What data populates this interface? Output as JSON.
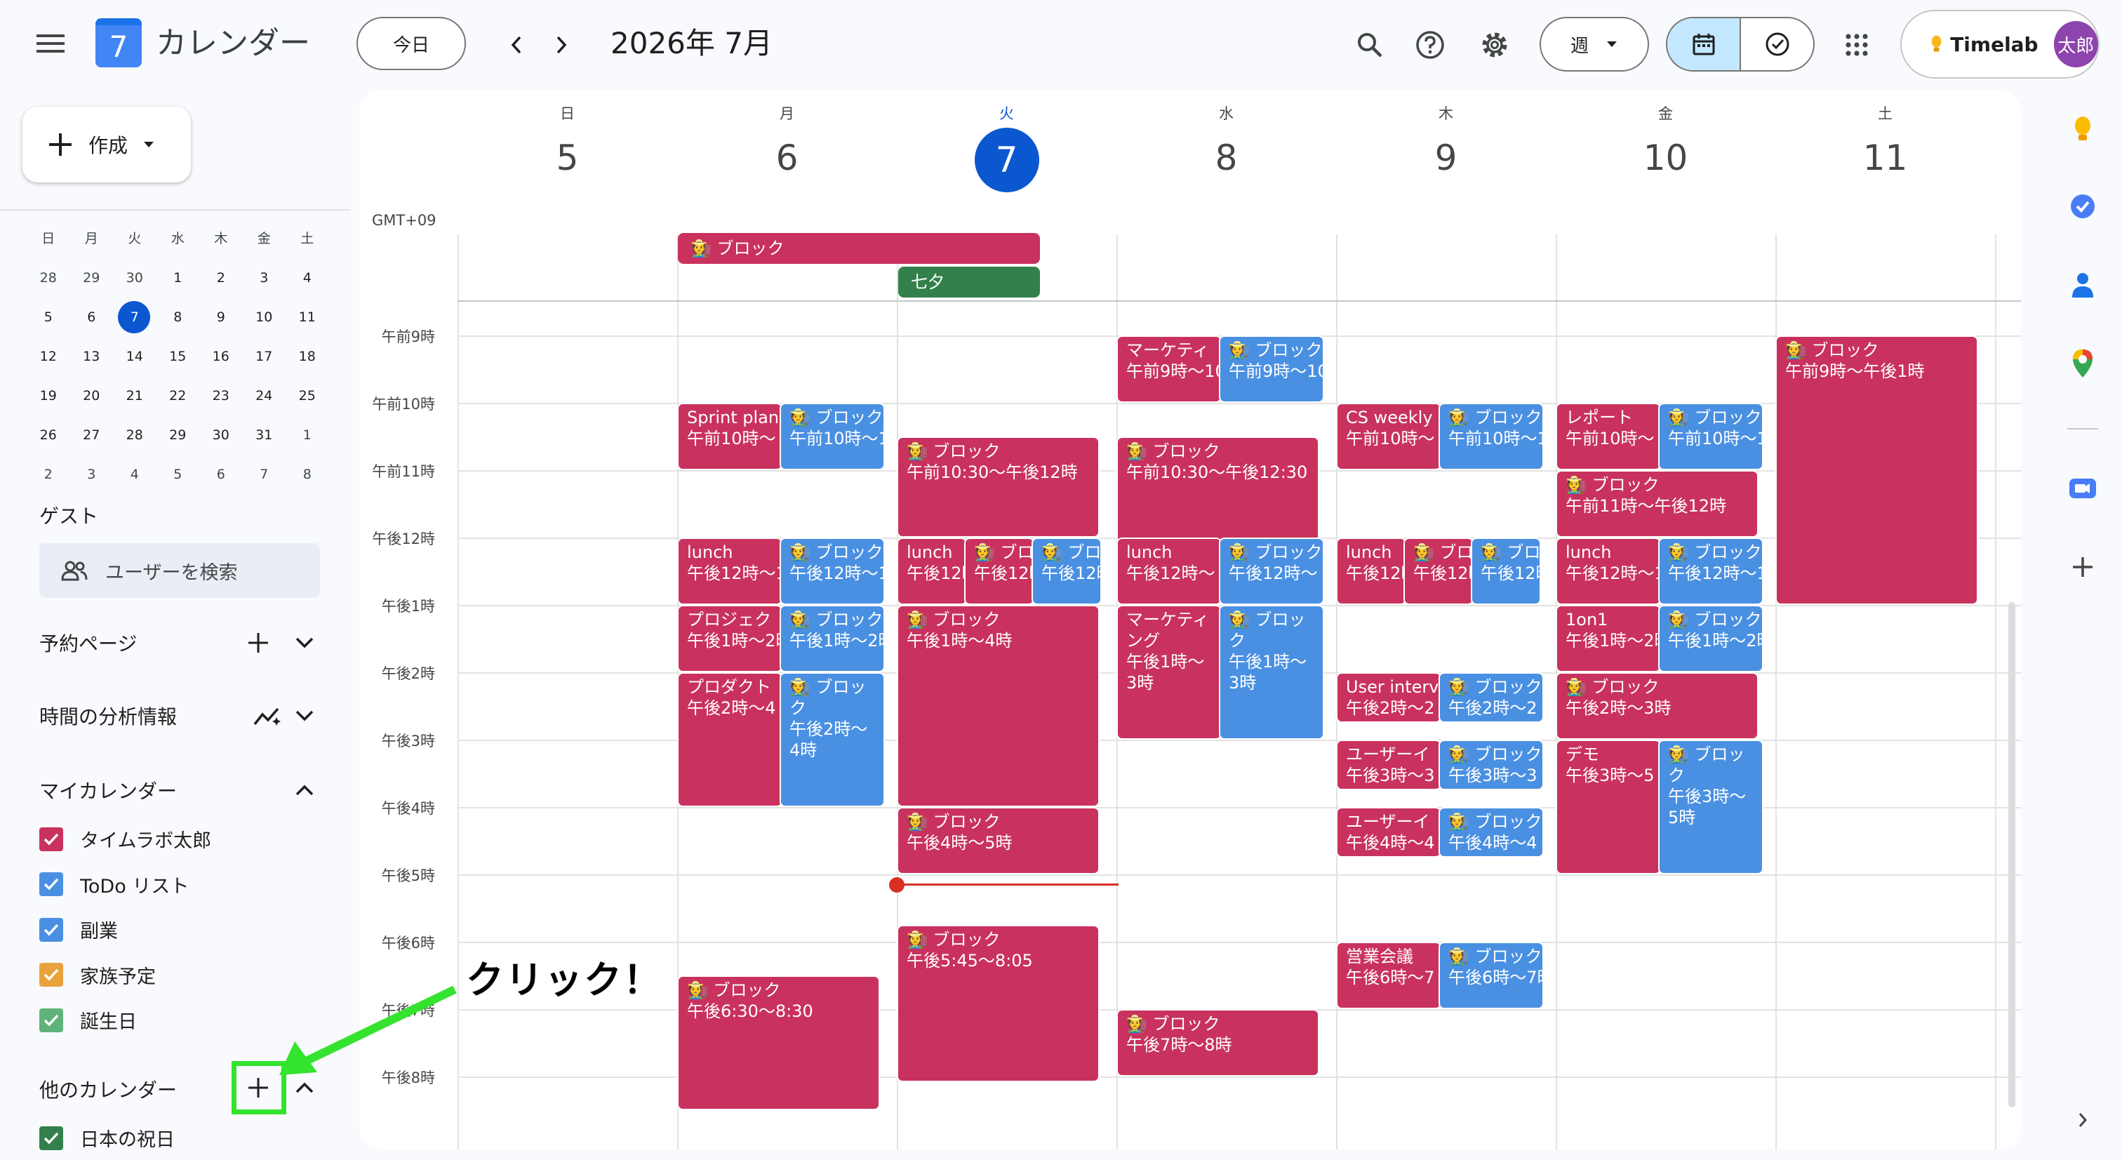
{
  "header": {
    "app_logo_day": "7",
    "app_title": "カレンダー",
    "today_button": "今日",
    "month_title": "2026年 7月",
    "view_selector": "週",
    "account_name": "Timelab",
    "avatar_text": "太郎"
  },
  "sidebar": {
    "create_button": "作成",
    "mini_calendar": {
      "weekdays": [
        "日",
        "月",
        "火",
        "水",
        "木",
        "金",
        "土"
      ],
      "weeks": [
        [
          "28",
          "29",
          "30",
          "1",
          "2",
          "3",
          "4"
        ],
        [
          "5",
          "6",
          "7",
          "8",
          "9",
          "10",
          "11"
        ],
        [
          "12",
          "13",
          "14",
          "15",
          "16",
          "17",
          "18"
        ],
        [
          "19",
          "20",
          "21",
          "22",
          "23",
          "24",
          "25"
        ],
        [
          "26",
          "27",
          "28",
          "29",
          "30",
          "31",
          "1"
        ],
        [
          "2",
          "3",
          "4",
          "5",
          "6",
          "7",
          "8"
        ]
      ]
    },
    "guest_label": "ゲスト",
    "search_users_placeholder": "ユーザーを検索",
    "booking_pages_label": "予約ページ",
    "time_insights_label": "時間の分析情報",
    "my_calendars_label": "マイカレンダー",
    "my_calendars": [
      {
        "name": "タイムラボ太郎",
        "color": "#c9325e"
      },
      {
        "name": "ToDo リスト",
        "color": "#4a90e2"
      },
      {
        "name": "副業",
        "color": "#4a90e2"
      },
      {
        "name": "家族予定",
        "color": "#e8a33d"
      },
      {
        "name": "誕生日",
        "color": "#5fb37a"
      }
    ],
    "other_calendars_label": "他のカレンダー",
    "other_calendars": [
      {
        "name": "日本の祝日",
        "color": "#33804c"
      }
    ]
  },
  "week": {
    "timezone": "GMT+09",
    "days": [
      {
        "dow": "日",
        "num": "5"
      },
      {
        "dow": "月",
        "num": "6"
      },
      {
        "dow": "火",
        "num": "7"
      },
      {
        "dow": "水",
        "num": "8"
      },
      {
        "dow": "木",
        "num": "9"
      },
      {
        "dow": "金",
        "num": "10"
      },
      {
        "dow": "土",
        "num": "11"
      }
    ],
    "time_labels": [
      "午前9時",
      "午前10時",
      "午前11時",
      "午後12時",
      "午後1時",
      "午後2時",
      "午後3時",
      "午後4時",
      "午後5時",
      "午後6時",
      "午後7時",
      "午後8時"
    ]
  },
  "allday_events": {
    "block": "🧑‍🌾 ブロック",
    "tanabata": "七夕"
  },
  "events": {
    "e1": {
      "title": "マーケティ",
      "time": "午前9時〜10"
    },
    "e2": {
      "title": "🧑‍🌾 ブロック",
      "time": "午前9時〜10"
    },
    "e3": {
      "title": "🧑‍🌾 ブロック",
      "time": "午前9時〜午後1時"
    },
    "e4": {
      "title": "Sprint plan",
      "time": "午前10時〜"
    },
    "e5": {
      "title": "🧑‍🌾 ブロック",
      "time": "午前10時〜1"
    },
    "e6": {
      "title": "CS weekly",
      "time": "午前10時〜"
    },
    "e7": {
      "title": "🧑‍🌾 ブロック",
      "time": "午前10時〜1"
    },
    "e8": {
      "title": "レポート",
      "time": "午前10時〜"
    },
    "e9": {
      "title": "🧑‍🌾 ブロック",
      "time": "午前10時〜1"
    },
    "e10": {
      "title": "🧑‍🌾 ブロック",
      "time": "午前10:30〜午後12時"
    },
    "e11": {
      "title": "🧑‍🌾 ブロック",
      "time": "午前10:30〜午後12:30"
    },
    "e12": {
      "title": "🧑‍🌾 ブロック",
      "time": "午前11時〜午後12時"
    },
    "e13": {
      "title": "lunch",
      "time": "午後12時〜1"
    },
    "e14": {
      "title": "🧑‍🌾 ブロック",
      "time": "午後12時〜1"
    },
    "e15": {
      "title": "lunch",
      "time": "午後12時"
    },
    "e16": {
      "title": "🧑‍🌾 ブロ",
      "time": "午後12時"
    },
    "e17": {
      "title": "🧑‍🌾 ブロ",
      "time": "午後12時"
    },
    "e18": {
      "title": "lunch",
      "time": "午後12時〜"
    },
    "e19": {
      "title": "🧑‍🌾 ブロック",
      "time": "午後12時〜"
    },
    "e20": {
      "title": "lunch",
      "time": "午後12時"
    },
    "e21": {
      "title": "🧑‍🌾 ブロ",
      "time": "午後12時"
    },
    "e22": {
      "title": "🧑‍🌾 ブロ",
      "time": "午後12時"
    },
    "e23": {
      "title": "lunch",
      "time": "午後12時〜1"
    },
    "e24": {
      "title": "🧑‍🌾 ブロック",
      "time": "午後12時〜1"
    },
    "e25": {
      "title": "プロジェク",
      "time": "午後1時〜2時"
    },
    "e26": {
      "title": "🧑‍🌾 ブロック",
      "time": "午後1時〜2時"
    },
    "e27": {
      "title": "🧑‍🌾 ブロック",
      "time": "午後1時〜4時"
    },
    "e28": {
      "title": "マーケティング",
      "time": "午後1時〜3時"
    },
    "e29": {
      "title": "🧑‍🌾 ブロック",
      "time": "午後1時〜3時"
    },
    "e30": {
      "title": "1on1",
      "time": "午後1時〜2時"
    },
    "e31": {
      "title": "🧑‍🌾 ブロック",
      "time": "午後1時〜2時"
    },
    "e32": {
      "title": "プロダクト",
      "time": "午後2時〜4"
    },
    "e33": {
      "title": "🧑‍🌾 ブロック",
      "time": "午後2時〜4時"
    },
    "e34": {
      "title": "User interv",
      "time": "午後2時〜2"
    },
    "e35": {
      "title": "🧑‍🌾 ブロック",
      "time": "午後2時〜2"
    },
    "e36": {
      "title": "🧑‍🌾 ブロック",
      "time": "午後2時〜3時"
    },
    "e37": {
      "title": "ユーザーイ",
      "time": "午後3時〜3"
    },
    "e38": {
      "title": "🧑‍🌾 ブロック",
      "time": "午後3時〜3"
    },
    "e39": {
      "title": "デモ",
      "time": "午後3時〜5"
    },
    "e40": {
      "title": "🧑‍🌾 ブロック",
      "time": "午後3時〜5時"
    },
    "e41": {
      "title": "🧑‍🌾 ブロック",
      "time": "午後4時〜5時"
    },
    "e42": {
      "title": "ユーザーイ",
      "time": "午後4時〜4"
    },
    "e43": {
      "title": "🧑‍🌾 ブロック",
      "time": "午後4時〜4"
    },
    "e44": {
      "title": "🧑‍🌾 ブロック",
      "time": "午後5:45〜8:05"
    },
    "e45": {
      "title": "営業会議",
      "time": "午後6時〜7"
    },
    "e46": {
      "title": "🧑‍🌾 ブロック",
      "time": "午後6時〜7時"
    },
    "e47": {
      "title": "🧑‍🌾 ブロック",
      "time": "午後6:30〜8:30"
    },
    "e48": {
      "title": "🧑‍🌾 ブロック",
      "time": "午後7時〜8時"
    }
  },
  "annotation": {
    "text": "クリック！"
  },
  "colors": {
    "accent": "#0b57d0",
    "event_red": "#c9325e",
    "event_blue": "#4a90e2",
    "event_green": "#33804c",
    "highlight_green": "#33e32e",
    "now_line": "#d93025"
  }
}
